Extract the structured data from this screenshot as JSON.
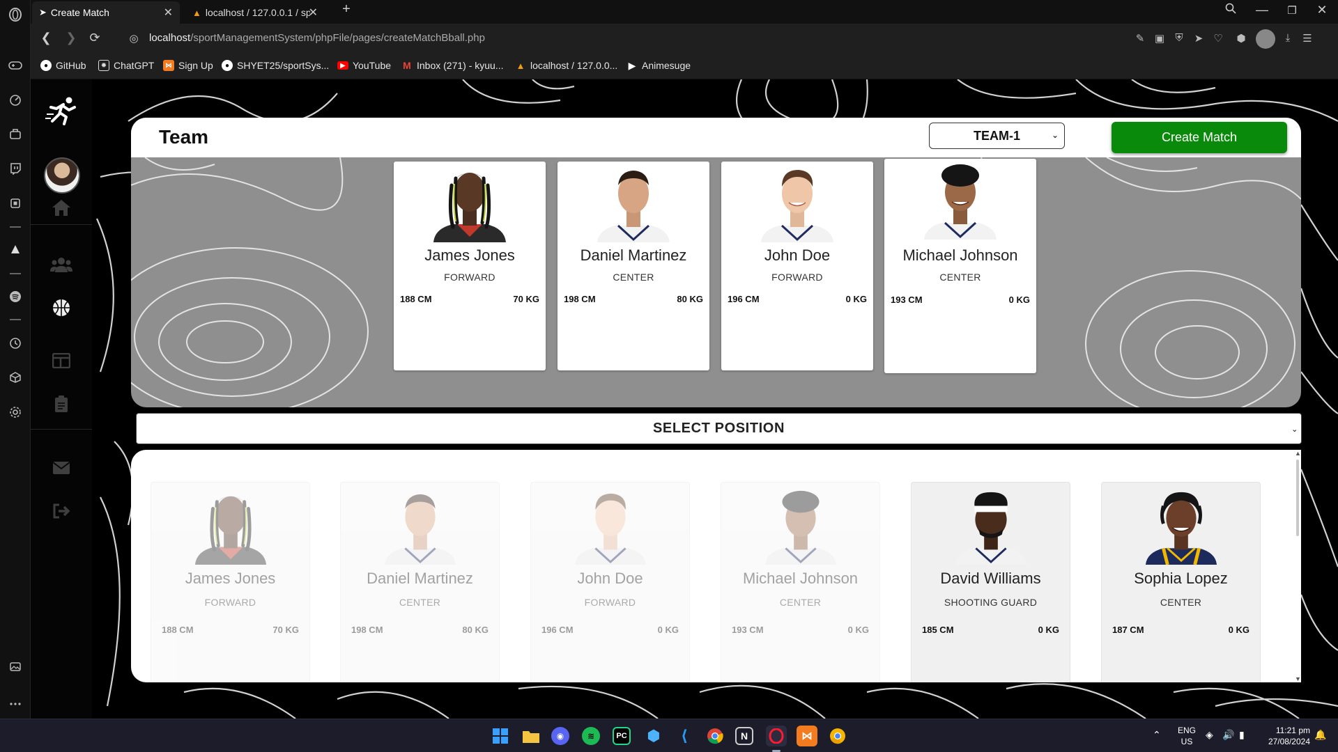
{
  "browser": {
    "tabs": [
      {
        "label": "Create Match",
        "active": true
      },
      {
        "label": "localhost / 127.0.0.1 / sp",
        "active": false
      }
    ],
    "new_tab": "+",
    "url_host": "localhost",
    "url_path": "/sportManagementSystem/phpFile/pages/createMatchBball.php",
    "bookmarks": [
      {
        "label": "GitHub",
        "icon": "github-icon"
      },
      {
        "label": "ChatGPT",
        "icon": "chatgpt-icon"
      },
      {
        "label": "Sign Up",
        "icon": "xampp-icon"
      },
      {
        "label": "SHYET25/sportSys...",
        "icon": "github-icon"
      },
      {
        "label": "YouTube",
        "icon": "youtube-icon"
      },
      {
        "label": "Inbox (271) - kyuu...",
        "icon": "gmail-icon"
      },
      {
        "label": "localhost / 127.0.0...",
        "icon": "phpmyadmin-icon"
      },
      {
        "label": "Animesuge",
        "icon": "play-icon"
      }
    ]
  },
  "team": {
    "title": "Team",
    "select_value": "TEAM-1",
    "create_button": "Create Match",
    "players": [
      {
        "name": "James Jones",
        "position": "FORWARD",
        "height": "188 CM",
        "weight": "70 KG"
      },
      {
        "name": "Daniel Martinez",
        "position": "CENTER",
        "height": "198 CM",
        "weight": "80 KG"
      },
      {
        "name": "John Doe",
        "position": "FORWARD",
        "height": "196 CM",
        "weight": "0 KG"
      },
      {
        "name": "Michael Johnson",
        "position": "CENTER",
        "height": "193 CM",
        "weight": "0 KG"
      }
    ]
  },
  "position_select": {
    "value": "SELECT POSITION"
  },
  "roster": [
    {
      "name": "James Jones",
      "position": "FORWARD",
      "height": "188 CM",
      "weight": "70 KG",
      "selected": true
    },
    {
      "name": "Daniel Martinez",
      "position": "CENTER",
      "height": "198 CM",
      "weight": "80 KG",
      "selected": true
    },
    {
      "name": "John Doe",
      "position": "FORWARD",
      "height": "196 CM",
      "weight": "0 KG",
      "selected": true
    },
    {
      "name": "Michael Johnson",
      "position": "CENTER",
      "height": "193 CM",
      "weight": "0 KG",
      "selected": true
    },
    {
      "name": "David Williams",
      "position": "SHOOTING GUARD",
      "height": "185 CM",
      "weight": "0 KG",
      "selected": false
    },
    {
      "name": "Sophia Lopez",
      "position": "CENTER",
      "height": "187 CM",
      "weight": "0 KG",
      "selected": false
    }
  ],
  "taskbar": {
    "lang_top": "ENG",
    "lang_bottom": "US",
    "time": "11:21 pm",
    "date": "27/08/2024"
  },
  "colors": {
    "accent_green": "#0a8a0a",
    "panel_gray": "#8f8f8f"
  }
}
